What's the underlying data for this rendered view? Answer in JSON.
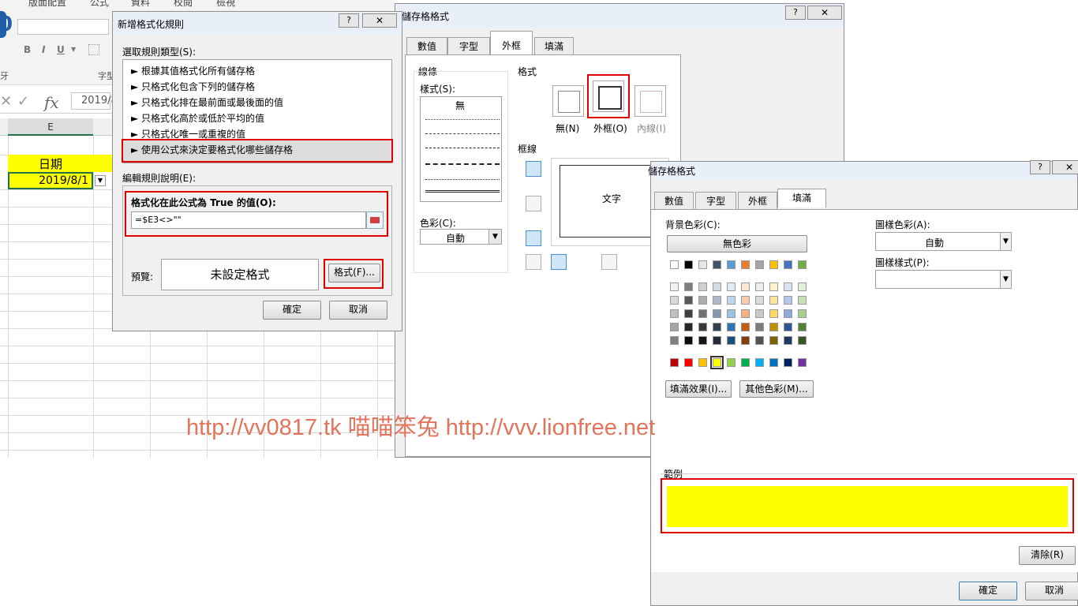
{
  "excel": {
    "ribbon_tabs": [
      "版面配置",
      "公式",
      "資料",
      "校閱",
      "檢視"
    ],
    "font_buttons": [
      "B",
      "I",
      "U"
    ],
    "font_group_label": "字型",
    "left_edge_letters": [
      "0",
      "牙"
    ],
    "fx_symbol": "fx",
    "formula_bar_value": "2019/8",
    "column_header": "E",
    "cell_header": "日期",
    "cell_value": "2019/8/1",
    "cell_header_color": "#ffff00"
  },
  "new_rule_dialog": {
    "title": "新增格式化規則",
    "help_label": "?",
    "close_label": "✕",
    "select_type_label": "選取規則類型(S):",
    "rule_types": [
      "► 根據其值格式化所有儲存格",
      "► 只格式化包含下列的儲存格",
      "► 只格式化排在最前面或最後面的值",
      "► 只格式化高於或低於平均的值",
      "► 只格式化唯一或重複的值",
      "► 使用公式來決定要格式化哪些儲存格"
    ],
    "selected_index": 5,
    "edit_desc_label": "編輯規則說明(E):",
    "formula_label": "格式化在此公式為 True 的值(O):",
    "formula_value": "=$E3<>\"\"",
    "preview_label": "預覽:",
    "preview_text": "未設定格式",
    "format_button": "格式(F)...",
    "ok_button": "確定",
    "cancel_button": "取消"
  },
  "border_dialog": {
    "title": "儲存格格式",
    "help_label": "?",
    "close_label": "✕",
    "tabs": [
      "數值",
      "字型",
      "外框",
      "填滿"
    ],
    "selected_tab": "外框",
    "line_group": "線條",
    "style_label": "樣式(S):",
    "style_none": "無",
    "color_label": "色彩(C):",
    "color_value": "自動",
    "presets_group": "格式",
    "preset_labels": [
      "無(N)",
      "外框(O)",
      "內線(I)"
    ],
    "border_group": "框線",
    "preview_text": "文字"
  },
  "fill_dialog": {
    "title": "儲存格格式",
    "help_label": "?",
    "close_label": "✕",
    "tabs": [
      "數值",
      "字型",
      "外框",
      "填滿"
    ],
    "selected_tab": "填滿",
    "bg_color_label": "背景色彩(C):",
    "no_color_button": "無色彩",
    "theme_row": [
      "#ffffff",
      "#000000",
      "#e7e6e6",
      "#44546a",
      "#5b9bd5",
      "#ed7d31",
      "#a5a5a5",
      "#ffc000",
      "#4472c4",
      "#70ad47"
    ],
    "tint_rows": [
      [
        "#f2f2f2",
        "#7f7f7f",
        "#d0cece",
        "#d6dce4",
        "#deebf6",
        "#fbe5d5",
        "#ededed",
        "#fff2cc",
        "#dae3f3",
        "#e2efd9"
      ],
      [
        "#d8d8d8",
        "#595959",
        "#aeabab",
        "#adb9ca",
        "#bdd7ee",
        "#f7cbac",
        "#dbdbdb",
        "#fee599",
        "#b4c6e7",
        "#c5e0b3"
      ],
      [
        "#bfbfbf",
        "#3f3f3f",
        "#757070",
        "#8496b0",
        "#9cc3e5",
        "#f4b183",
        "#c9c9c9",
        "#ffd965",
        "#8eaadb",
        "#a8d08d"
      ],
      [
        "#a5a5a5",
        "#262626",
        "#3a3838",
        "#323f4f",
        "#2e75b5",
        "#c55a11",
        "#7b7b7b",
        "#bf9000",
        "#2f5496",
        "#538135"
      ],
      [
        "#7f7f7f",
        "#0c0c0c",
        "#171616",
        "#222a35",
        "#1e4e79",
        "#833c0b",
        "#525252",
        "#7f6000",
        "#1f3864",
        "#375623"
      ]
    ],
    "standard_row": [
      "#c00000",
      "#ff0000",
      "#ffc000",
      "#ffff00",
      "#92d050",
      "#00b050",
      "#00b0f0",
      "#0070c0",
      "#002060",
      "#7030a0"
    ],
    "selected_standard": 3,
    "fill_effects_button": "填滿效果(I)...",
    "more_colors_button": "其他色彩(M)...",
    "pattern_color_label": "圖樣色彩(A):",
    "pattern_color_value": "自動",
    "pattern_style_label": "圖樣樣式(P):",
    "sample_label": "範例",
    "sample_color": "#ffff00",
    "clear_button": "清除(R)",
    "ok_button": "確定",
    "cancel_button": "取消"
  },
  "watermark": "http://vv0817.tk 喵喵笨兔 http://vvv.lionfree.net",
  "colors": {
    "highlight_red": "#e00000",
    "excel_green": "#217346",
    "watermark": "#e3745c"
  }
}
